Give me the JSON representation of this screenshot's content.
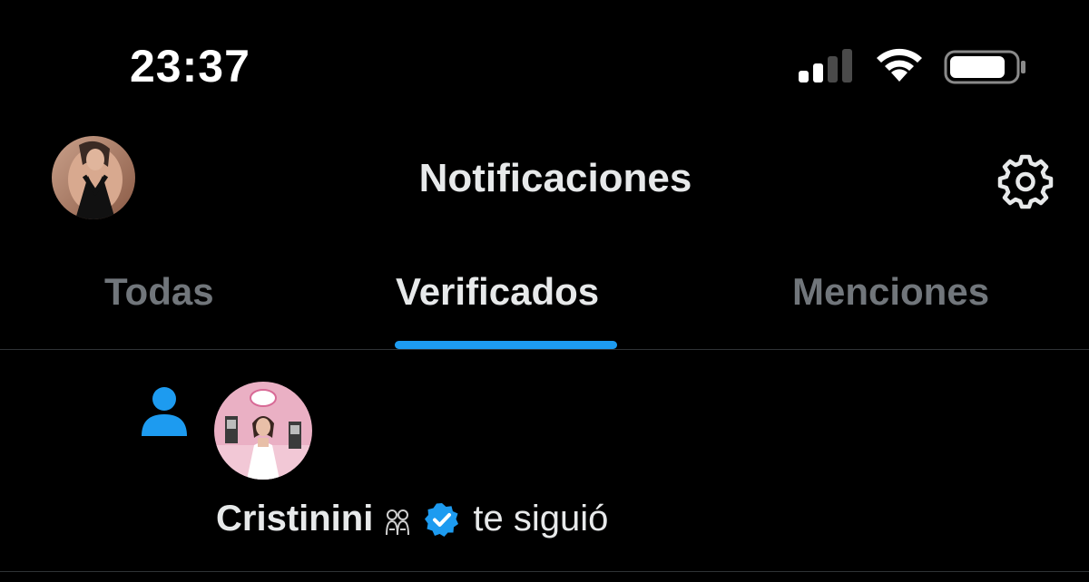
{
  "status_bar": {
    "time": "23:37",
    "icons": [
      "cellular-signal-icon",
      "wifi-icon",
      "battery-icon"
    ]
  },
  "header": {
    "title": "Notificaciones",
    "settings_icon": "gear-icon"
  },
  "tabs": [
    {
      "label": "Todas",
      "active": false
    },
    {
      "label": "Verificados",
      "active": true
    },
    {
      "label": "Menciones",
      "active": false
    }
  ],
  "notifications": [
    {
      "type_icon": "person-icon",
      "name": "Cristinini",
      "emoji": "👯",
      "verified_icon": "verified-badge-icon",
      "action": "te siguió"
    }
  ],
  "colors": {
    "background": "#000000",
    "text_primary": "#e7e9ea",
    "text_secondary": "#71767b",
    "accent": "#1d9bf0",
    "divider": "#2f3336"
  }
}
